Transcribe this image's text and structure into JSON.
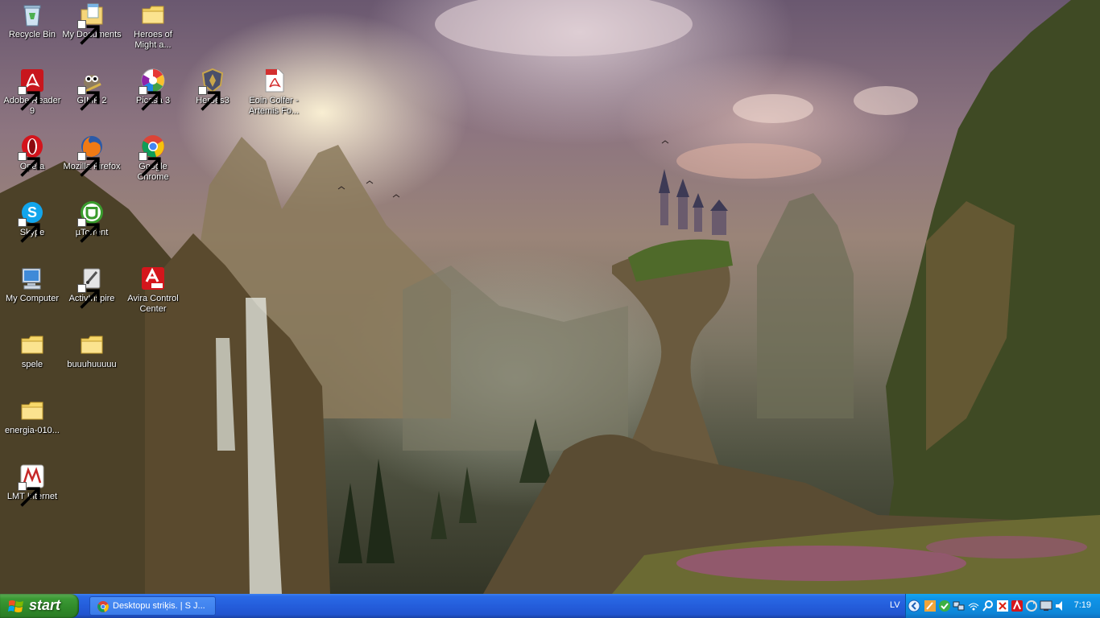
{
  "desktop": {
    "icons": [
      {
        "label": "Recycle Bin",
        "icon": "recycle-bin-icon"
      },
      {
        "label": "My Documents",
        "icon": "my-documents-icon"
      },
      {
        "label": "Heroes of Might a...",
        "icon": "folder-icon"
      },
      {
        "label": "Adobe Reader 9",
        "icon": "adobe-reader-icon"
      },
      {
        "label": "GIMP 2",
        "icon": "gimp-icon"
      },
      {
        "label": "Picasa 3",
        "icon": "picasa-icon"
      },
      {
        "label": "Heroes3",
        "icon": "heroes3-icon"
      },
      {
        "label": "Eoin Colfer - Artemis Fo...",
        "icon": "pdf-file-icon"
      },
      {
        "label": "Opera",
        "icon": "opera-icon"
      },
      {
        "label": "Mozilla Firefox",
        "icon": "firefox-icon"
      },
      {
        "label": "Google Chrome",
        "icon": "chrome-icon"
      },
      {
        "label": "Skype",
        "icon": "skype-icon"
      },
      {
        "label": "µTorrent",
        "icon": "utorrent-icon"
      },
      {
        "label": "My Computer",
        "icon": "my-computer-icon"
      },
      {
        "label": "ActivInspire",
        "icon": "activinspire-icon"
      },
      {
        "label": "Avira Control Center",
        "icon": "avira-icon"
      },
      {
        "label": "spele",
        "icon": "folder-icon"
      },
      {
        "label": "buuuhuuuuu",
        "icon": "folder-icon"
      },
      {
        "label": "energia-010...",
        "icon": "folder-icon"
      },
      {
        "label": "LMT Internet",
        "icon": "lmt-internet-icon"
      }
    ]
  },
  "taskbar": {
    "start_label": "start",
    "task_label": "Desktopu striķis. | S J...",
    "language": "LV",
    "clock": "7:19"
  },
  "colors": {
    "taskbar_blue": "#245ddb",
    "start_green": "#3c9a35",
    "tray_blue": "#0f94e8"
  }
}
